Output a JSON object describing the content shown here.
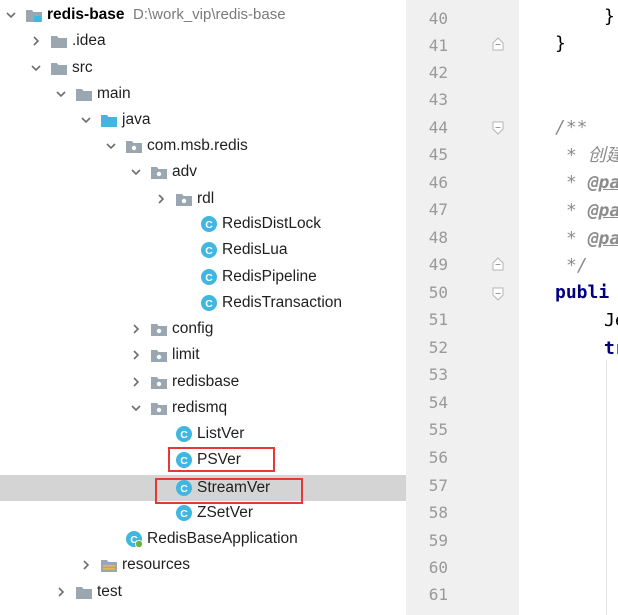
{
  "tree": {
    "rows": [
      {
        "label": "redis-base",
        "path": "D:\\work_vip\\redis-base",
        "icon": "module-folder-icon",
        "expanded": true
      },
      {
        "label": ".idea",
        "icon": "folder-icon",
        "expanded": false
      },
      {
        "label": "src",
        "icon": "folder-icon",
        "expanded": true
      },
      {
        "label": "main",
        "icon": "folder-icon",
        "expanded": true
      },
      {
        "label": "java",
        "icon": "source-folder-icon",
        "expanded": true
      },
      {
        "label": "com.msb.redis",
        "icon": "package-icon",
        "expanded": true
      },
      {
        "label": "adv",
        "icon": "package-icon",
        "expanded": true
      },
      {
        "label": "rdl",
        "icon": "package-icon",
        "expanded": false
      },
      {
        "label": "RedisDistLock",
        "icon": "java-class-icon"
      },
      {
        "label": "RedisLua",
        "icon": "java-class-icon"
      },
      {
        "label": "RedisPipeline",
        "icon": "java-class-icon"
      },
      {
        "label": "RedisTransaction",
        "icon": "java-class-icon"
      },
      {
        "label": "config",
        "icon": "package-icon",
        "expanded": false
      },
      {
        "label": "limit",
        "icon": "package-icon",
        "expanded": false
      },
      {
        "label": "redisbase",
        "icon": "package-icon",
        "expanded": false
      },
      {
        "label": "redismq",
        "icon": "package-icon",
        "expanded": true
      },
      {
        "label": "ListVer",
        "icon": "java-class-icon"
      },
      {
        "label": "PSVer",
        "icon": "java-class-icon",
        "highlighted": true
      },
      {
        "label": "StreamVer",
        "icon": "java-class-icon",
        "highlighted": true,
        "selected": true
      },
      {
        "label": "ZSetVer",
        "icon": "java-class-icon"
      },
      {
        "label": "RedisBaseApplication",
        "icon": "spring-boot-class-icon"
      },
      {
        "label": "resources",
        "icon": "resources-folder-icon",
        "expanded": false
      },
      {
        "label": "test",
        "icon": "folder-icon",
        "expanded": false
      }
    ]
  },
  "editor": {
    "line_numbers": [
      "40",
      "41",
      "42",
      "43",
      "44",
      "45",
      "46",
      "47",
      "48",
      "49",
      "50",
      "51",
      "52",
      "53",
      "54",
      "55",
      "56",
      "57",
      "58",
      "59",
      "60",
      "61"
    ],
    "code": {
      "l40": "}",
      "l41": "}",
      "l44": "/**",
      "l45_star": "* ",
      "l45_text": "创建",
      "l46_star": "* ",
      "l46_tag": "@pa",
      "l47_star": "* ",
      "l47_tag": "@pa",
      "l48_star": "* ",
      "l48_tag": "@pa",
      "l49": "*/",
      "l50": "publi",
      "l51": "Je",
      "l52": "tr"
    }
  },
  "colors": {
    "selection": "#d4d4d4",
    "highlight_box": "#e53935",
    "gutter": "#f0f0f0",
    "keyword": "#000080",
    "comment": "#8c8c8c"
  }
}
